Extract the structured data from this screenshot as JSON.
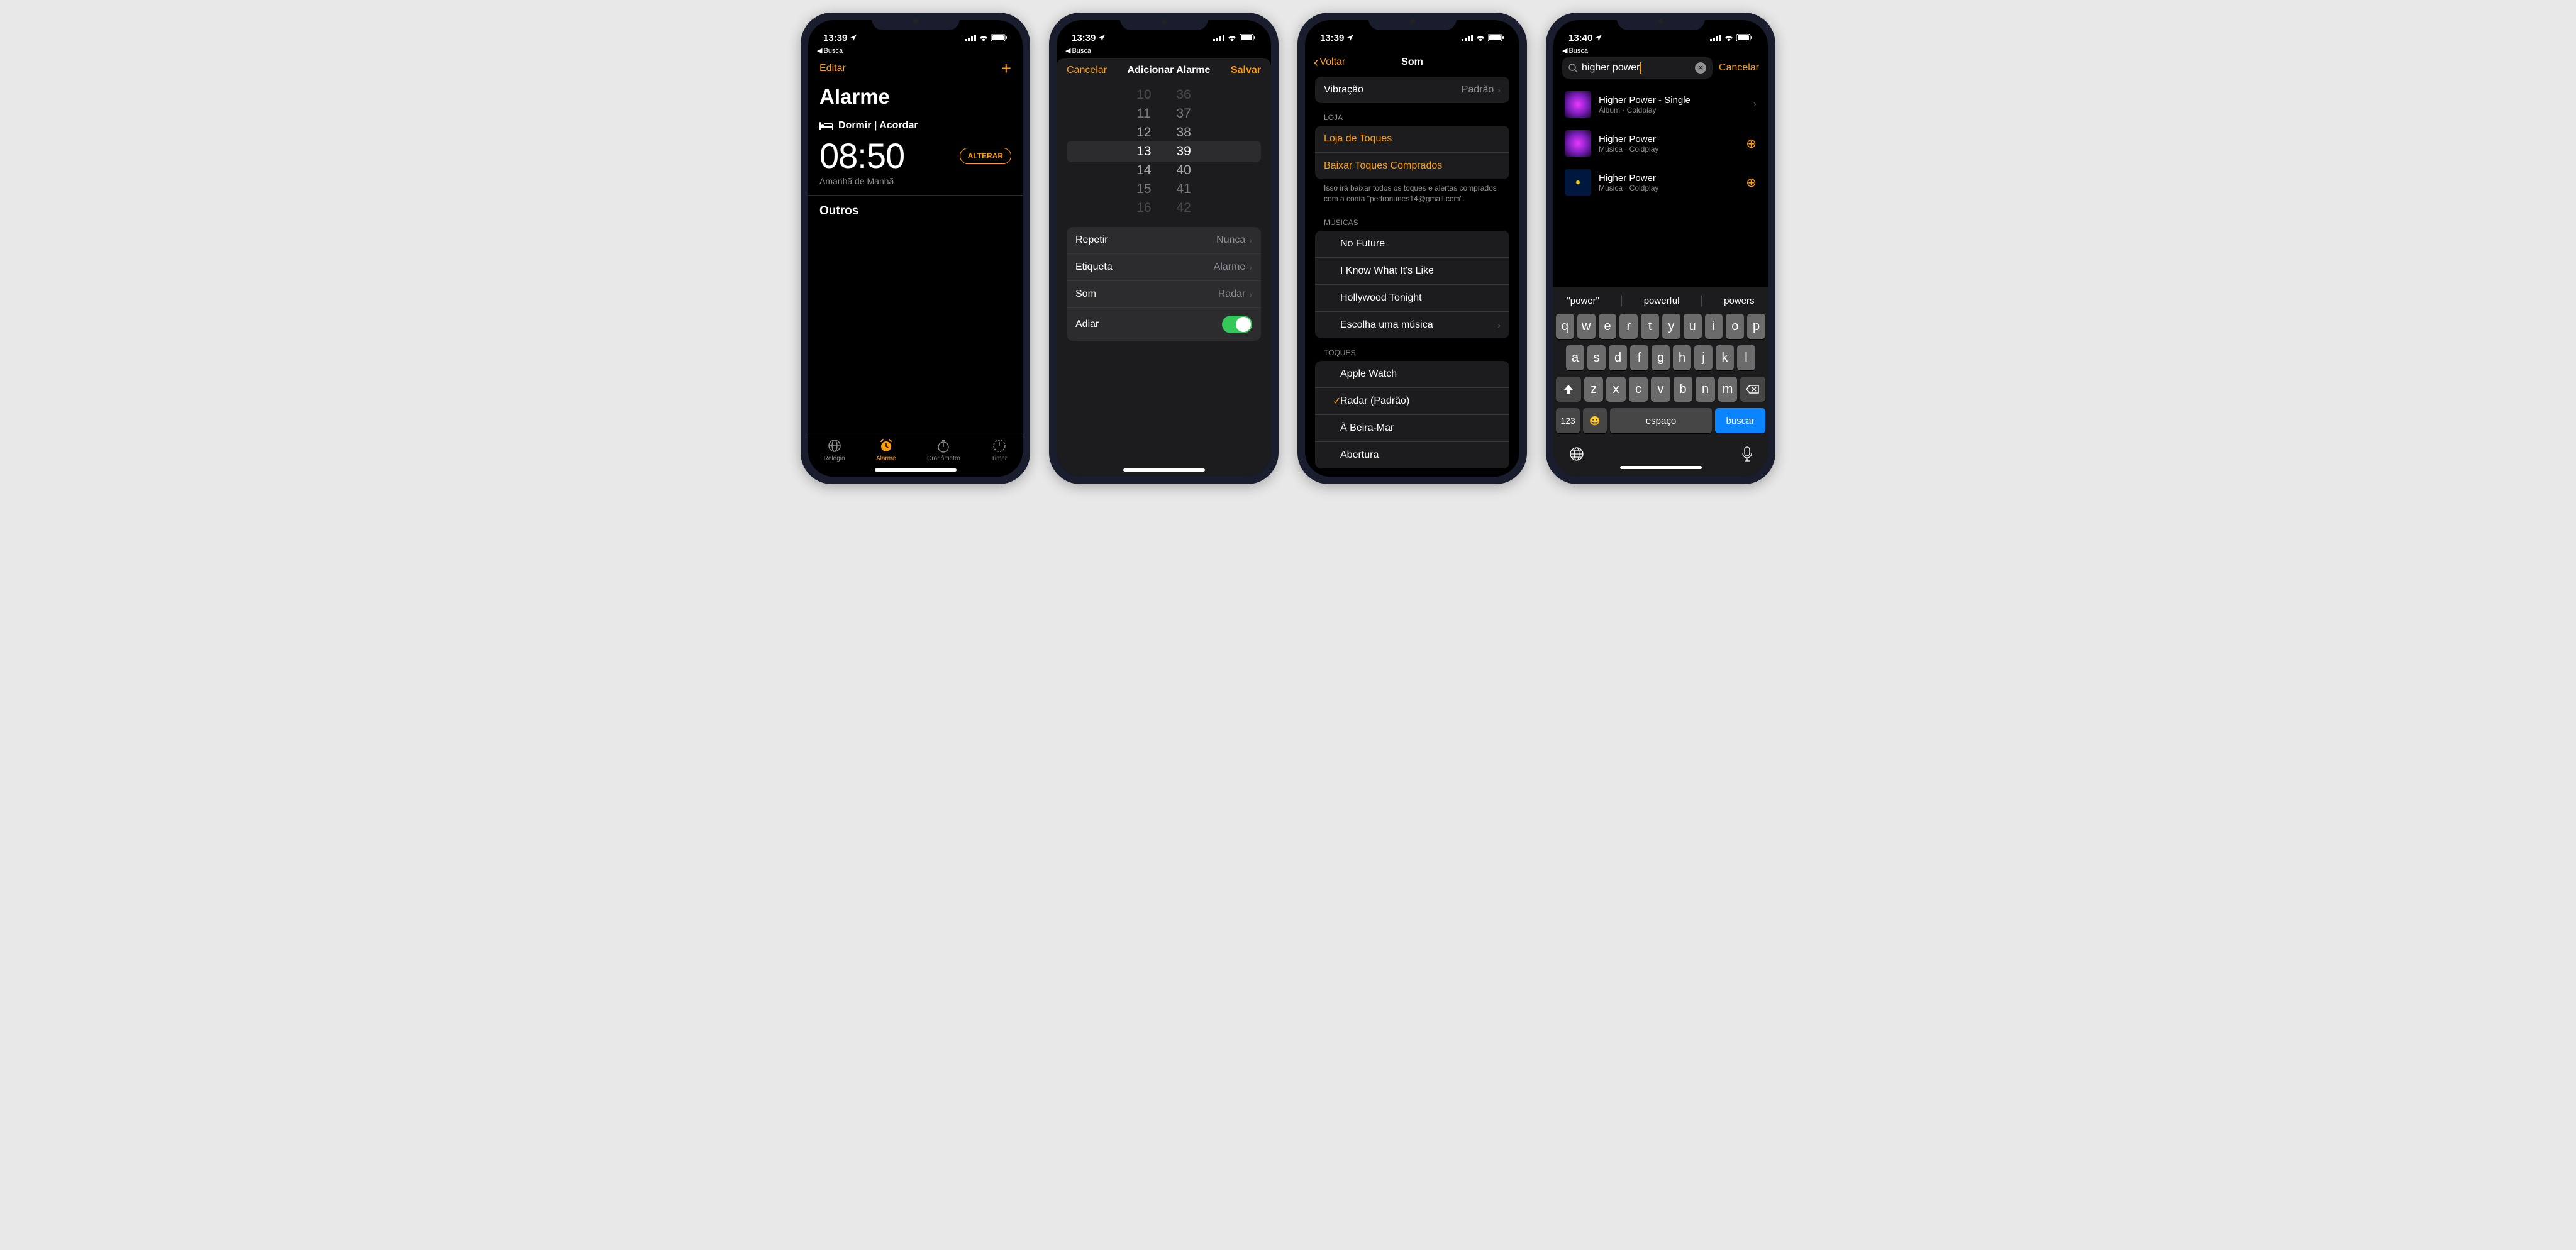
{
  "status": {
    "time1": "13:39",
    "time2": "13:39",
    "time3": "13:39",
    "time4": "13:40",
    "back": "Busca"
  },
  "screen1": {
    "edit": "Editar",
    "title": "Alarme",
    "sleep_wake": "Dormir | Acordar",
    "time": "08:50",
    "change": "ALTERAR",
    "tomorrow": "Amanhã de Manhã",
    "others": "Outros",
    "tabs": {
      "clock": "Relógio",
      "alarm": "Alarme",
      "stopwatch": "Cronômetro",
      "timer": "Timer"
    }
  },
  "screen2": {
    "cancel": "Cancelar",
    "title": "Adicionar Alarme",
    "save": "Salvar",
    "picker": {
      "hours": [
        "10",
        "11",
        "12",
        "13",
        "14",
        "15",
        "16"
      ],
      "mins": [
        "36",
        "37",
        "38",
        "39",
        "40",
        "41",
        "42"
      ]
    },
    "rows": {
      "repeat_label": "Repetir",
      "repeat_value": "Nunca",
      "label_label": "Etiqueta",
      "label_value": "Alarme",
      "sound_label": "Som",
      "sound_value": "Radar",
      "snooze_label": "Adiar"
    }
  },
  "screen3": {
    "back": "Voltar",
    "title": "Som",
    "vibration_label": "Vibração",
    "vibration_value": "Padrão",
    "store_header": "LOJA",
    "store_link": "Loja de Toques",
    "download_link": "Baixar Toques Comprados",
    "note": "Isso irá baixar todos os toques e alertas comprados com a conta \"pedronunes14@gmail.com\".",
    "songs_header": "MÚSICAS",
    "songs": [
      "No Future",
      "I Know What It's Like",
      "Hollywood Tonight"
    ],
    "choose_song": "Escolha uma música",
    "tones_header": "TOQUES",
    "tones": [
      "Apple Watch",
      "Radar (Padrão)",
      "À Beira-Mar",
      "Abertura"
    ],
    "selected_index": 1
  },
  "screen4": {
    "query": "higher power",
    "cancel": "Cancelar",
    "results": [
      {
        "title": "Higher Power - Single",
        "sub": "Álbum · Coldplay",
        "action": "chevron"
      },
      {
        "title": "Higher Power",
        "sub": "Música · Coldplay",
        "action": "add"
      },
      {
        "title": "Higher Power",
        "sub": "Música · Coldplay",
        "action": "add",
        "art": "alt"
      }
    ],
    "suggestions": [
      "\"power\"",
      "powerful",
      "powers"
    ],
    "keys_row1": [
      "q",
      "w",
      "e",
      "r",
      "t",
      "y",
      "u",
      "i",
      "o",
      "p"
    ],
    "keys_row2": [
      "a",
      "s",
      "d",
      "f",
      "g",
      "h",
      "j",
      "k",
      "l"
    ],
    "keys_row3": [
      "z",
      "x",
      "c",
      "v",
      "b",
      "n",
      "m"
    ],
    "key_123": "123",
    "key_space": "espaço",
    "key_search": "buscar"
  }
}
